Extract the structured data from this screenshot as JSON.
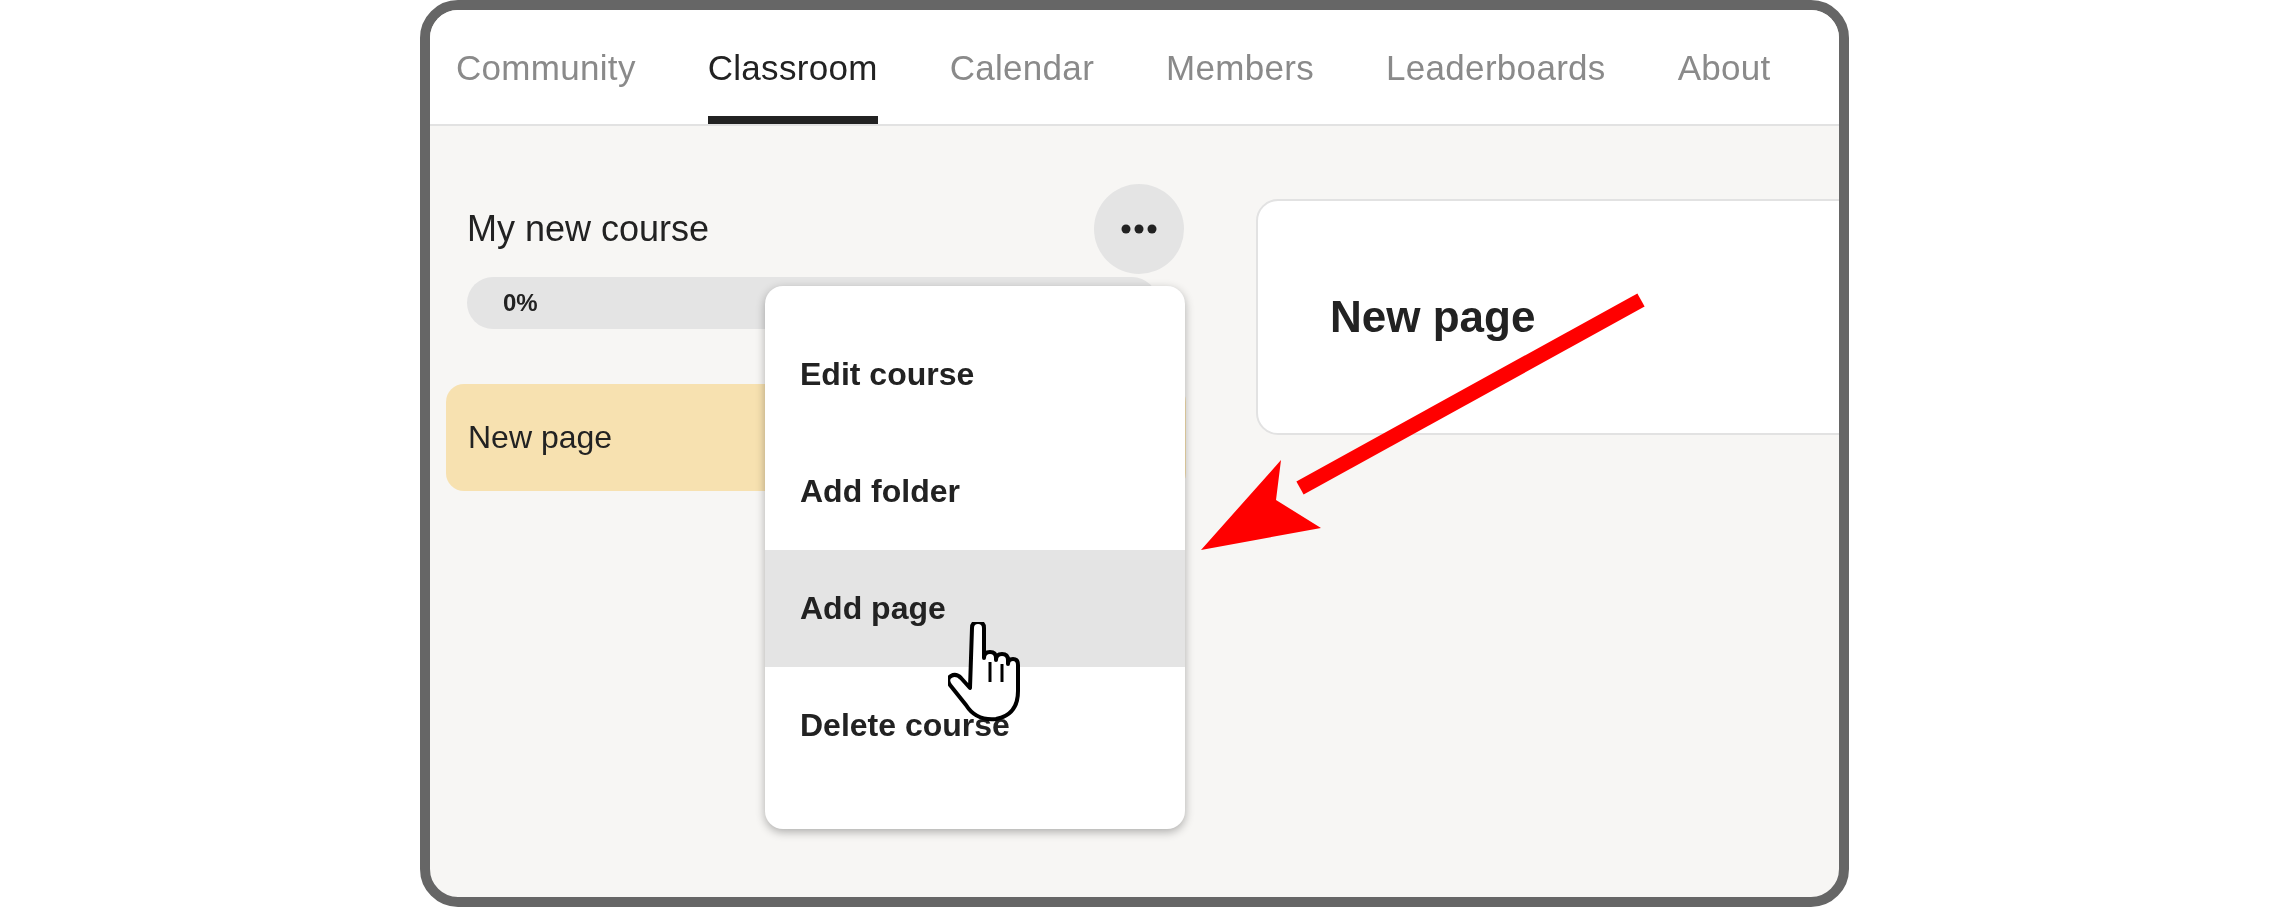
{
  "tabs": [
    {
      "label": "Community",
      "selected": false
    },
    {
      "label": "Classroom",
      "selected": true
    },
    {
      "label": "Calendar",
      "selected": false
    },
    {
      "label": "Members",
      "selected": false
    },
    {
      "label": "Leaderboards",
      "selected": false
    },
    {
      "label": "About",
      "selected": false
    }
  ],
  "course": {
    "title": "My new course",
    "progress": {
      "level": 0,
      "reading": "0%"
    },
    "lessons": [
      {
        "title": "New page",
        "selected": true
      }
    ]
  },
  "menu": [
    {
      "label": "Edit course",
      "selected": false
    },
    {
      "label": "Add folder",
      "selected": false
    },
    {
      "label": "Add page",
      "selected": true
    },
    {
      "label": "Delete course",
      "selected": false
    }
  ],
  "page": {
    "title": "New page"
  }
}
